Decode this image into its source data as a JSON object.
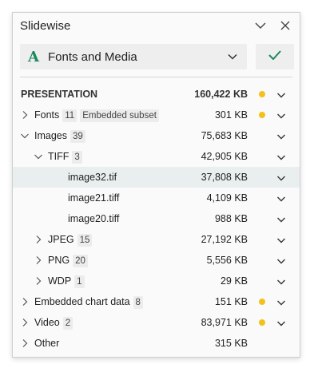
{
  "window": {
    "title": "Slidewise"
  },
  "dropdown": {
    "icon": "font-a-icon",
    "glyph": "A",
    "label": "Fonts and Media"
  },
  "colors": {
    "accent": "#1b8a5a",
    "dot": "#f2c21a",
    "selected_row": "#e9efee"
  },
  "tree": [
    {
      "name": "PRESENTATION",
      "size": "160,422 KB",
      "header": true,
      "dot": true,
      "indent": 0,
      "expander": "none"
    },
    {
      "name": "Fonts",
      "count": "11",
      "tag": "Embedded subset",
      "size": "301 KB",
      "dot": true,
      "indent": 0,
      "expander": "collapsed"
    },
    {
      "name": "Images",
      "count": "39",
      "size": "75,683 KB",
      "dot": false,
      "indent": 0,
      "expander": "expanded"
    },
    {
      "name": "TIFF",
      "count": "3",
      "size": "42,905 KB",
      "dot": false,
      "indent": 1,
      "expander": "expanded"
    },
    {
      "name": "image32.tif",
      "size": "37,808 KB",
      "dot": false,
      "indent": 2,
      "expander": "none",
      "selected": true
    },
    {
      "name": "image21.tiff",
      "size": "4,109 KB",
      "dot": false,
      "indent": 2,
      "expander": "none"
    },
    {
      "name": "image20.tiff",
      "size": "988 KB",
      "dot": false,
      "indent": 2,
      "expander": "none"
    },
    {
      "name": "JPEG",
      "count": "15",
      "size": "27,192 KB",
      "dot": false,
      "indent": 1,
      "expander": "collapsed"
    },
    {
      "name": "PNG",
      "count": "20",
      "size": "5,556 KB",
      "dot": false,
      "indent": 1,
      "expander": "collapsed"
    },
    {
      "name": "WDP",
      "count": "1",
      "size": "29 KB",
      "dot": false,
      "indent": 1,
      "expander": "collapsed"
    },
    {
      "name": "Embedded chart data",
      "count": "8",
      "size": "151 KB",
      "dot": true,
      "indent": 0,
      "expander": "collapsed"
    },
    {
      "name": "Video",
      "count": "2",
      "size": "83,971 KB",
      "dot": true,
      "indent": 0,
      "expander": "collapsed"
    },
    {
      "name": "Other",
      "size": "315 KB",
      "dot": false,
      "indent": 0,
      "expander": "collapsed",
      "no_chevron": true
    }
  ]
}
